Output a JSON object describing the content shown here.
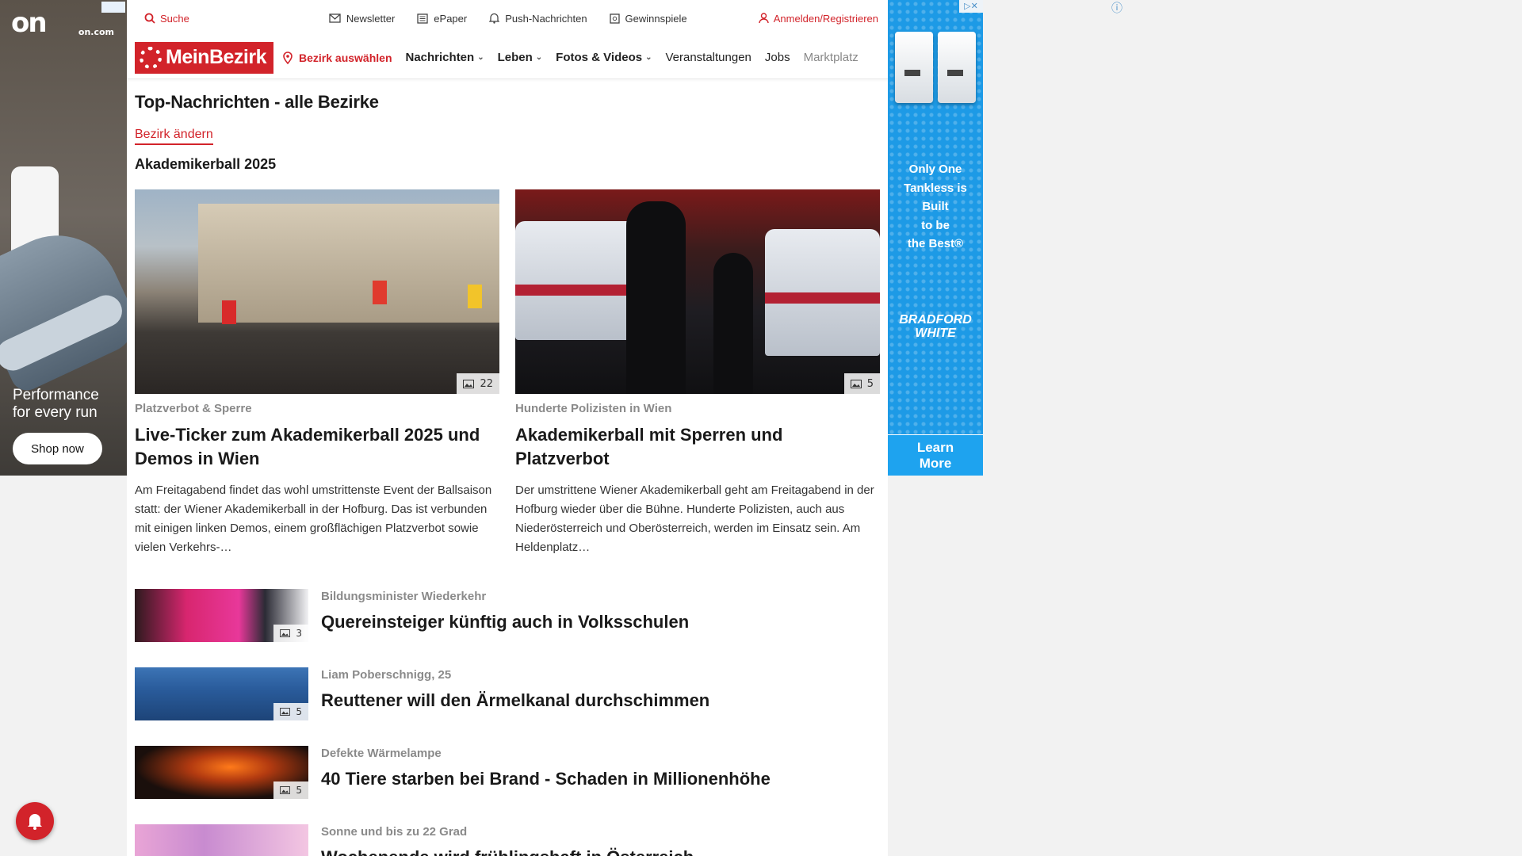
{
  "ads": {
    "left": {
      "brand": "on",
      "domain": "on.com",
      "slogan_line1": "Performance",
      "slogan_line2": "for every run",
      "cta": "Shop now"
    },
    "right": {
      "tagline": [
        "Only One",
        "Tankless is",
        "Built",
        "to be",
        "the Best®"
      ],
      "brand_line1": "BRADFORD",
      "brand_line2": "WHITE",
      "cta_line1": "Learn",
      "cta_line2": "More"
    }
  },
  "topbar": {
    "search": "Suche",
    "newsletter": "Newsletter",
    "epaper": "ePaper",
    "push": "Push-Nachrichten",
    "gewinnspiele": "Gewinnspiele",
    "login": "Anmelden/Registrieren"
  },
  "navbar": {
    "logo": "MeinBezirk",
    "bezirk": "Bezirk auswählen",
    "items": [
      "Nachrichten",
      "Leben",
      "Fotos & Videos",
      "Veranstaltungen",
      "Jobs",
      "Marktplatz"
    ]
  },
  "page": {
    "title": "Top-Nachrichten - alle Bezirke",
    "change_link": "Bezirk ändern",
    "section": "Akademikerball 2025"
  },
  "featured": [
    {
      "photos": "22",
      "kicker": "Platzverbot & Sperre",
      "headline": "Live-Ticker zum Akademikerball 2025 und Demos in Wien",
      "teaser": "Am Freitagabend findet das wohl umstrittenste Event der Ballsaison statt: der Wiener Akademikerball in der Hofburg. Das ist verbunden mit einigen linken Demos, einem großflächigen Platzverbot sowie vielen Verkehrs-…"
    },
    {
      "photos": "5",
      "kicker": "Hunderte Polizisten in Wien",
      "headline": "Akademikerball mit Sperren und Platzverbot",
      "teaser": "Der umstrittene Wiener Akademikerball geht am Freitagabend in der Hofburg wieder über die Bühne. Hunderte Polizisten, auch aus Niederösterreich und Oberösterreich, werden im Einsatz sein. Am Heldenplatz…"
    }
  ],
  "list": [
    {
      "photos": "3",
      "kicker": "Bildungsminister Wiederkehr",
      "headline": "Quereinsteiger künftig auch in Volksschulen"
    },
    {
      "photos": "5",
      "kicker": "Liam Poberschnigg, 25",
      "headline": "Reuttener will den Ärmelkanal durchschimmen"
    },
    {
      "photos": "5",
      "kicker": "Defekte Wärmelampe",
      "headline": "40 Tiere starben bei Brand - Schaden in Millionenhöhe"
    },
    {
      "photos": "",
      "kicker": "Sonne und bis zu 22 Grad",
      "headline": "Wochenende wird frühlingshaft in Österreich"
    }
  ],
  "colors": {
    "brand_red": "#d2232a",
    "ad_blue": "#1d9ae6"
  }
}
